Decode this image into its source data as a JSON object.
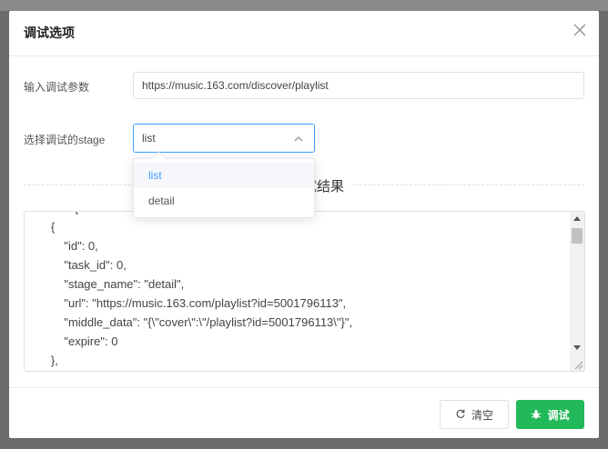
{
  "dialog": {
    "title": "调试选项"
  },
  "form": {
    "params_label": "输入调试参数",
    "params_value": "https://music.163.com/discover/playlist",
    "stage_label": "选择调试的stage",
    "stage_selected": "list"
  },
  "dropdown": {
    "options": [
      "list",
      "detail"
    ],
    "highlighted": "list"
  },
  "result": {
    "divider_text": "调试结果",
    "text": "\t\"next\": [\n\t\t{\n\t\t\t\"id\": 0,\n\t\t\t\"task_id\": 0,\n\t\t\t\"stage_name\": \"detail\",\n\t\t\t\"url\": \"https://music.163.com/playlist?id=5001796113\",\n\t\t\t\"middle_data\": \"{\\\"cover\\\":\\\"/playlist?id=5001796113\\\"}\",\n\t\t\t\"expire\": 0\n\t\t},\n\t\t{"
  },
  "footer": {
    "clear_label": "清空",
    "debug_label": "调试"
  },
  "colors": {
    "primary": "#409eff",
    "success": "#21b959"
  },
  "icons": {
    "close": "close-icon",
    "chevron": "chevron-up-icon",
    "clear": "refresh-icon",
    "debug": "bug-icon"
  }
}
